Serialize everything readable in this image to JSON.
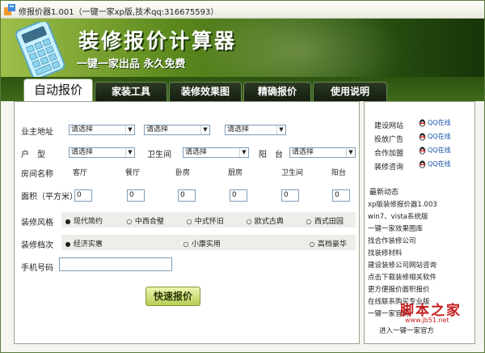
{
  "window": {
    "title": "修报价器1.001（一键一家xp版,技术qq:316675593）"
  },
  "banner": {
    "title": "装修报价计算器",
    "subtitle": "一键一家出品 永久免费"
  },
  "tabs": [
    {
      "label": "自动报价"
    },
    {
      "label": "家装工具"
    },
    {
      "label": "装修效果图"
    },
    {
      "label": "精确报价"
    },
    {
      "label": "使用说明"
    }
  ],
  "form": {
    "address_label": "业主地址",
    "address_selects": [
      "请选择",
      "请选择",
      "请选择"
    ],
    "layout_labels": {
      "hu_xing": "户　型",
      "bathroom": "卫生间",
      "balcony": "阳　台"
    },
    "layout_selects": [
      "请选择",
      "请选择",
      "请选择"
    ],
    "rooms_label": "房间名称",
    "rooms": [
      "客厅",
      "餐厅",
      "卧房",
      "厨房",
      "卫生间",
      "阳台"
    ],
    "area_label": "面积（平方米）",
    "areas": [
      "0",
      "0",
      "0",
      "0",
      "0",
      "0"
    ],
    "style_label": "装修风格",
    "styles": [
      "现代简约",
      "中西合璧",
      "中式怀旧",
      "欧式古典",
      "西式田园"
    ],
    "grade_label": "装修档次",
    "grades": [
      "经济实惠",
      "小康实用",
      "高档豪华"
    ],
    "phone_label": "手机号码",
    "phone_value": "",
    "submit_label": "快速报价"
  },
  "sidebar": {
    "services": [
      {
        "label": "建设网站",
        "qq": "QQ在线"
      },
      {
        "label": "投放广告",
        "qq": "QQ在线"
      },
      {
        "label": "合作加盟",
        "qq": "QQ在线"
      },
      {
        "label": "装修咨询",
        "qq": "QQ在线"
      }
    ],
    "news_title": "最新动态",
    "news": [
      "xp版装修报价器1.003",
      "win7、vista系统版",
      "一键一家效果图库",
      "找合作装修公司",
      "找装修材料",
      "建设装修公司网站咨询",
      "点击下载装修相关软件",
      "更方便报价面积报价",
      "在线联系购买专业版",
      "一键一家官网",
      "进入一键一家官方"
    ]
  },
  "watermark": {
    "text": "脚本之家",
    "url": "www.jb51.net"
  },
  "colors": {
    "accent_green": "#3f6a1c",
    "link_blue": "#1450a8",
    "watermark_red": "#c51d1d"
  }
}
